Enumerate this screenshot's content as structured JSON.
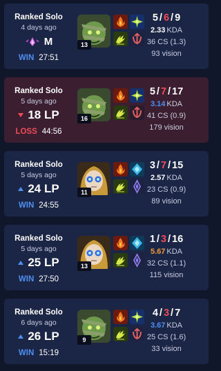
{
  "colors": {
    "win_bg": "#1b2546",
    "loss_bg": "#3b1f31",
    "win_text": "#4f8ff0",
    "loss_text": "#ef4b57",
    "ratio_white": "#ffffff",
    "ratio_blue": "#4f8ff0",
    "ratio_orange": "#f39a3b"
  },
  "matches": [
    {
      "queue": "Ranked Solo",
      "when": "4 days ago",
      "lp_kind": "rank",
      "lp": "M",
      "lp_icon": "master-rank-emblem-icon",
      "result": "WIN",
      "duration": "27:51",
      "champion_icon": "amumu-champion-icon",
      "level": "13",
      "spells": [
        "ignite-spell-icon",
        "ghost-spell-icon"
      ],
      "runes": [
        "smite-spell-icon",
        "precision-rune-icon"
      ],
      "kills": "5",
      "deaths": "6",
      "assists": "9",
      "kda": "2.33",
      "kda_label": "KDA",
      "cs": "36 CS (1.3)",
      "vision": "93 vision"
    },
    {
      "queue": "Ranked Solo",
      "when": "5 days ago",
      "lp_kind": "down",
      "lp": "18 LP",
      "result": "LOSS",
      "duration": "44:56",
      "champion_icon": "amumu-champion-icon",
      "level": "16",
      "spells": [
        "ignite-spell-icon",
        "ghost-spell-icon"
      ],
      "runes": [
        "smite-spell-icon",
        "precision-rune-icon"
      ],
      "kills": "5",
      "deaths": "7",
      "assists": "17",
      "kda": "3.14",
      "kda_label": "KDA",
      "cs": "41 CS (0.9)",
      "vision": "179 vision"
    },
    {
      "queue": "Ranked Solo",
      "when": "5 days ago",
      "lp_kind": "up",
      "lp": "24 LP",
      "result": "WIN",
      "duration": "24:55",
      "champion_icon": "orianna-champion-icon",
      "level": "11",
      "spells": [
        "ignite-spell-icon",
        "teleport-spell-icon"
      ],
      "runes": [
        "smite-spell-icon",
        "sorcery-rune-icon"
      ],
      "kills": "3",
      "deaths": "7",
      "assists": "15",
      "kda": "2.57",
      "kda_label": "KDA",
      "cs": "23 CS (0.9)",
      "vision": "89 vision"
    },
    {
      "queue": "Ranked Solo",
      "when": "5 days ago",
      "lp_kind": "up",
      "lp": "25 LP",
      "result": "WIN",
      "duration": "27:50",
      "champion_icon": "orianna-champion-icon",
      "level": "13",
      "spells": [
        "ignite-spell-icon",
        "teleport-spell-icon"
      ],
      "runes": [
        "smite-spell-icon",
        "sorcery-rune-icon"
      ],
      "kills": "1",
      "deaths": "3",
      "assists": "16",
      "kda": "5.67",
      "kda_label": "KDA",
      "cs": "32 CS (1.1)",
      "vision": "115 vision"
    },
    {
      "queue": "Ranked Solo",
      "when": "6 days ago",
      "lp_kind": "up",
      "lp": "26 LP",
      "result": "WIN",
      "duration": "15:19",
      "champion_icon": "amumu-champion-icon",
      "level": "9",
      "spells": [
        "ignite-spell-icon",
        "ghost-spell-icon"
      ],
      "runes": [
        "smite-spell-icon",
        "precision-rune-icon"
      ],
      "kills": "4",
      "deaths": "3",
      "assists": "7",
      "kda": "3.67",
      "kda_label": "KDA",
      "cs": "25 CS (1.6)",
      "vision": "33 vision"
    }
  ]
}
